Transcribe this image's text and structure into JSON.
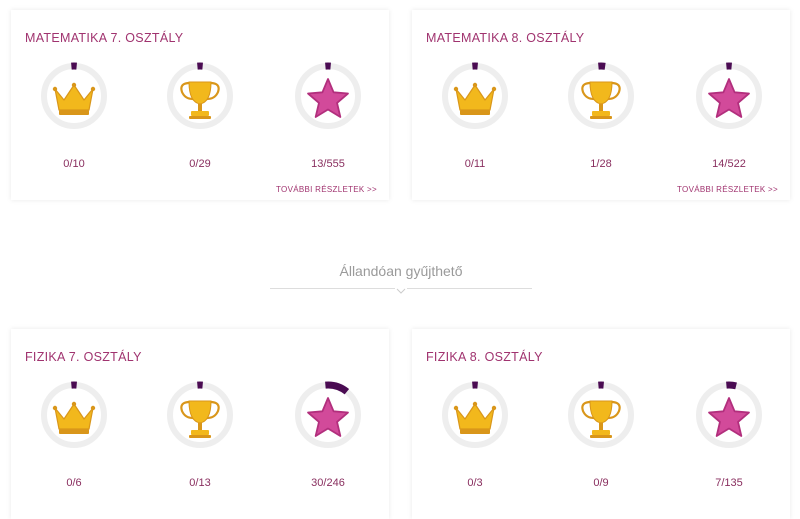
{
  "colors": {
    "title": "#a0336f",
    "value": "#8a3060",
    "ring_track": "#eeeeee",
    "ring_progress": "#4a0b52",
    "gold": "#f2b81c",
    "gold_dark": "#d9961a",
    "star": "#d24a9a",
    "star_dark": "#b22f7d"
  },
  "divider": {
    "title": "Állandóan gyűjthető"
  },
  "cards": [
    {
      "title": "MATEMATIKA 7. OSZTÁLY",
      "more_label": "TOVÁBBI RÉSZLETEK >>",
      "badges": [
        {
          "icon": "crown-icon",
          "value": "0/10",
          "progress": 0.0
        },
        {
          "icon": "trophy-icon",
          "value": "0/29",
          "progress": 0.0
        },
        {
          "icon": "star-icon",
          "value": "13/555",
          "progress": 0.023
        }
      ]
    },
    {
      "title": "MATEMATIKA 8. OSZTÁLY",
      "more_label": "TOVÁBBI RÉSZLETEK >>",
      "badges": [
        {
          "icon": "crown-icon",
          "value": "0/11",
          "progress": 0.0
        },
        {
          "icon": "trophy-icon",
          "value": "1/28",
          "progress": 0.036
        },
        {
          "icon": "star-icon",
          "value": "14/522",
          "progress": 0.027
        }
      ]
    },
    {
      "title": "FIZIKA 7. OSZTÁLY",
      "more_label": "",
      "badges": [
        {
          "icon": "crown-icon",
          "value": "0/6",
          "progress": 0.0
        },
        {
          "icon": "trophy-icon",
          "value": "0/13",
          "progress": 0.0
        },
        {
          "icon": "star-icon",
          "value": "30/246",
          "progress": 0.122
        }
      ]
    },
    {
      "title": "FIZIKA 8. OSZTÁLY",
      "more_label": "",
      "badges": [
        {
          "icon": "crown-icon",
          "value": "0/3",
          "progress": 0.0
        },
        {
          "icon": "trophy-icon",
          "value": "0/9",
          "progress": 0.0
        },
        {
          "icon": "star-icon",
          "value": "7/135",
          "progress": 0.052
        }
      ]
    }
  ]
}
